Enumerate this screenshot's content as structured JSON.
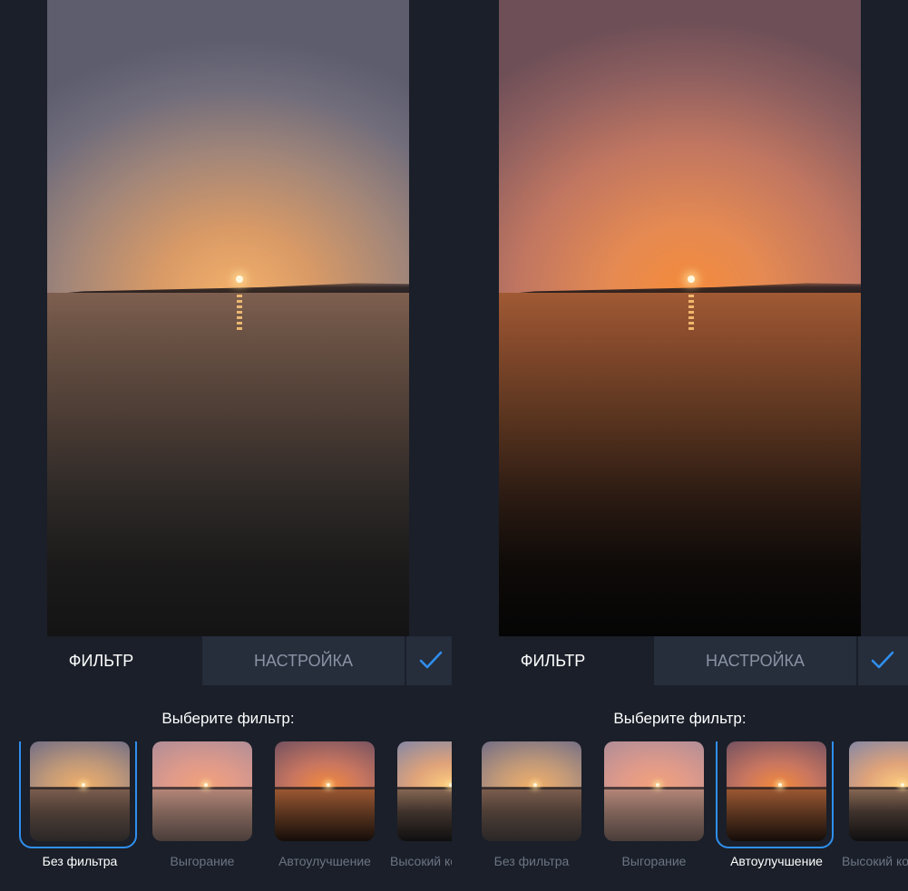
{
  "screens": [
    {
      "tabs": {
        "filter_label": "ФИЛЬТР",
        "settings_label": "НАСТРОЙКА"
      },
      "prompt": "Выберите фильтр:",
      "filters": [
        "Без фильтра",
        "Выгорание",
        "Автоулучшение",
        "Высокий ко"
      ],
      "selected_filter": "Без фильтра"
    },
    {
      "tabs": {
        "filter_label": "ФИЛЬТР",
        "settings_label": "НАСТРОЙКА"
      },
      "prompt": "Выберите фильтр:",
      "filters": [
        "Без фильтра",
        "Выгорание",
        "Автоулучшение",
        "Высокий ко"
      ],
      "selected_filter": "Автоулучшение"
    }
  ],
  "colors": {
    "background": "#1a1f29",
    "inactive_tab": "#262d3b",
    "accent": "#2f8fef",
    "muted_text": "#6d7584"
  },
  "icons": {
    "confirm": "checkmark-icon"
  }
}
